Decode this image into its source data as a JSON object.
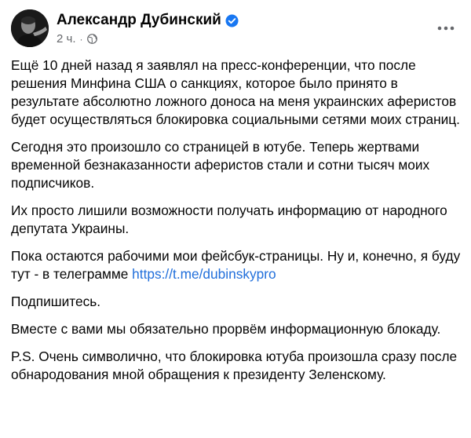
{
  "post": {
    "author_name": "Александр Дубинский",
    "timestamp": "2 ч.",
    "separator": "·",
    "icons": {
      "verified": "verified-badge-icon",
      "audience": "globe-icon",
      "more": "more-options-icon"
    },
    "colors": {
      "text": "#050505",
      "meta": "#65676b",
      "link": "#216fdb",
      "verified": "#1877f2"
    },
    "paragraphs": [
      {
        "text": "Ещё 10 дней назад я заявлял на пресс-конференции, что после решения Минфина США о санкциях, которое было принято в результате абсолютно ложного доноса на меня украинских аферистов будет осуществляться блокировка социальными сетями моих страниц."
      },
      {
        "text": "Сегодня это произошло со страницей в ютубе. Теперь жертвами временной безнаказанности аферистов стали и сотни тысяч моих подписчиков."
      },
      {
        "text": "Их просто лишили возможности получать информацию от народного депутата Украины."
      },
      {
        "text": "Пока остаются рабочими мои фейсбук-страницы. Ну и, конечно, я буду тут - в телеграмме ",
        "link": "https://t.me/dubinskypro"
      },
      {
        "text": "Подпишитесь."
      },
      {
        "text": "Вместе с вами мы обязательно прорвём информационную блокаду."
      },
      {
        "text": "P.S. Очень символично, что блокировка ютуба произошла сразу после обнародования мной обращения к президенту Зеленскому."
      }
    ]
  }
}
